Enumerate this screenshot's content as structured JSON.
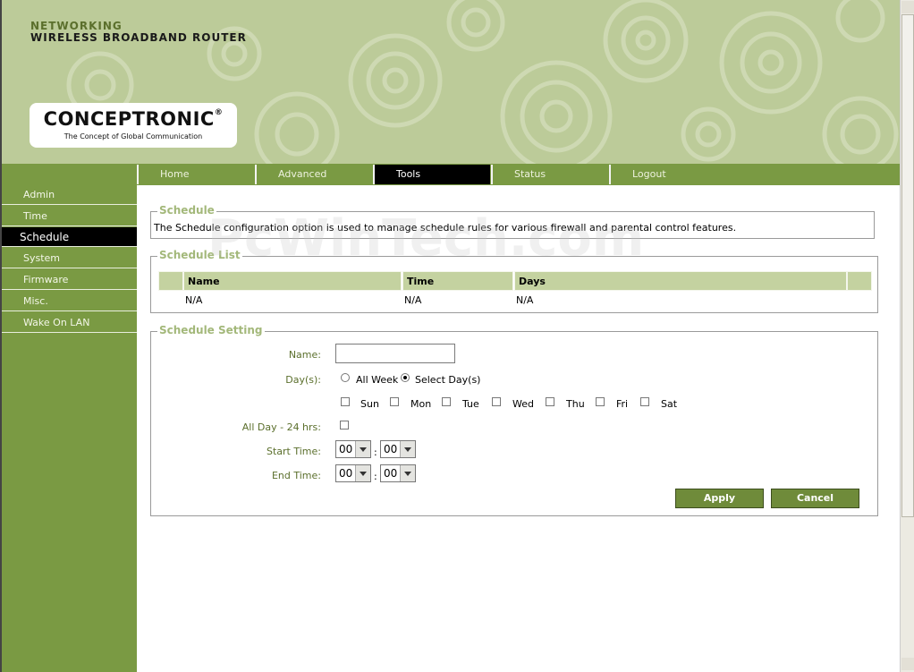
{
  "header": {
    "brand_small": "NETWORKING",
    "brand_big": "WIRELESS BROADBAND ROUTER",
    "logo": "CONCEPTRONIC",
    "logo_mark": "®",
    "tagline": "The Concept of Global Communication"
  },
  "tabs": [
    {
      "label": "Home"
    },
    {
      "label": "Advanced"
    },
    {
      "label": "Tools",
      "active": true
    },
    {
      "label": "Status"
    },
    {
      "label": "Logout"
    }
  ],
  "sidebar": [
    {
      "label": "Admin"
    },
    {
      "label": "Time"
    },
    {
      "label": "Schedule",
      "active": true
    },
    {
      "label": "System"
    },
    {
      "label": "Firmware"
    },
    {
      "label": "Misc."
    },
    {
      "label": "Wake On LAN"
    }
  ],
  "schedule": {
    "legend": "Schedule",
    "description": "The Schedule configuration option is used to manage schedule rules for various firewall and parental control features."
  },
  "list": {
    "legend": "Schedule List",
    "headers": [
      "Name",
      "Time",
      "Days"
    ],
    "row": [
      "N/A",
      "N/A",
      "N/A"
    ]
  },
  "setting": {
    "legend": "Schedule Setting",
    "name_label": "Name:",
    "name_value": "",
    "days_label": "Day(s):",
    "all_week": "All Week",
    "select_days": "Select Day(s)",
    "days": [
      "Sun",
      "Mon",
      "Tue",
      "Wed",
      "Thu",
      "Fri",
      "Sat"
    ],
    "allday_label": "All Day - 24 hrs:",
    "start_label": "Start Time:",
    "end_label": "End Time:",
    "start_hour": "00",
    "start_min": "00",
    "end_hour": "00",
    "end_min": "00",
    "colon": ":",
    "apply": "Apply",
    "cancel": "Cancel"
  },
  "watermark": "PcWinTech.com",
  "colors": {
    "green": "#7a9a43",
    "header_bg": "#bccb99",
    "legend": "#a3b87a",
    "label": "#5b6f2c"
  }
}
